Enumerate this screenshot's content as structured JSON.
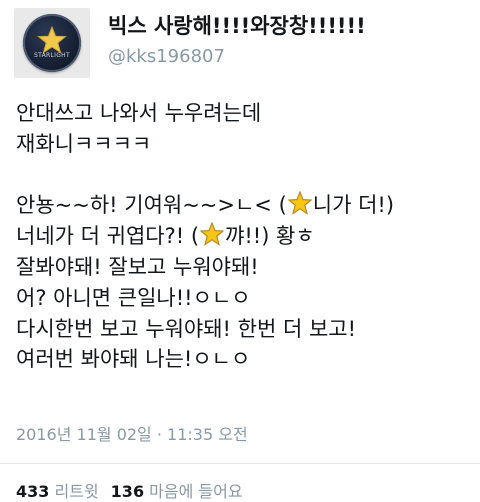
{
  "profile": {
    "display_name": "빅스 사랑해!!!!와장창!!!!!!",
    "handle": "@kks196807",
    "avatar_text": "STARLIGHT"
  },
  "tweet": {
    "line1": "안대쓰고 나와서 누우려는데",
    "line2": "재화니ㅋㅋㅋㅋ",
    "line3_a": "안뇽~~하! 기여워~~>ㄴ< (",
    "line3_b": "니가 더!)",
    "line4_a": "너네가 더 귀엽다?! (",
    "line4_b": "꺄!!) 황ㅎ",
    "line5": "잘봐야돼! 잘보고 누워야돼!",
    "line6": "어? 아니면 큰일나!!ㅇㄴㅇ",
    "line7": "다시한번 보고 누워야돼! 한번 더 보고!",
    "line8": "여러번 봐야돼 나는!ㅇㄴㅇ",
    "star_icon_color": "#f5c518"
  },
  "timestamp": "2016년 11월 02일 · 11:35 오전",
  "stats": {
    "retweets_count": "433",
    "retweets_label": "리트윗",
    "likes_count": "136",
    "likes_label": "마음에 들어요"
  }
}
